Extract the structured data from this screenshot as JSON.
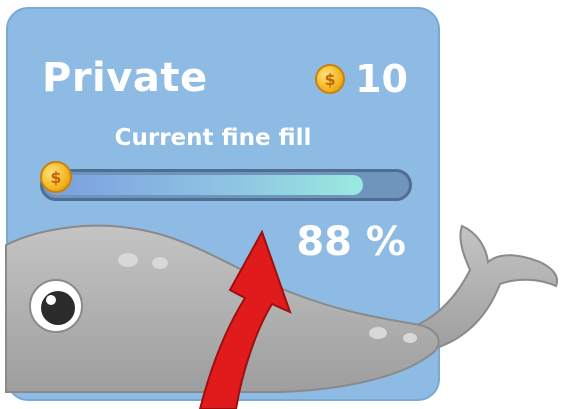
{
  "card": {
    "title": "Private",
    "coin_icon": "coin-icon",
    "coin_count": "10",
    "subtitle": "Current fine fill",
    "progress": {
      "fraction": 0.88,
      "label": "88 %"
    }
  },
  "colors": {
    "card_bg": "#8dbbe4",
    "whale_body": "#b5b5b5",
    "arrow": "#e11b1b",
    "coin": "#f4b521"
  },
  "decorations": {
    "mascot": "whale-icon",
    "pointer": "red-arrow-icon"
  }
}
